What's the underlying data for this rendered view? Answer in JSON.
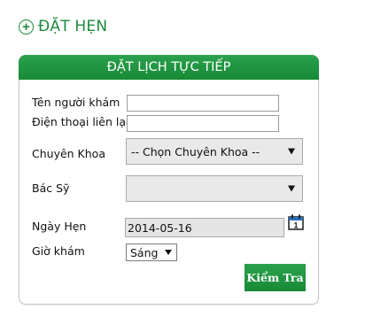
{
  "page": {
    "heading": "ĐẶT HẸN"
  },
  "form": {
    "title": "ĐẶT LỊCH TỰC TIẾP",
    "fields": {
      "patient_name": {
        "label": "Tên người khám",
        "value": ""
      },
      "phone": {
        "label": "Điện thoại liên lạc",
        "value": ""
      },
      "specialty": {
        "label": "Chuyên Khoa",
        "selected": "-- Chọn Chuyên Khoa --"
      },
      "doctor": {
        "label": "Bác Sỹ",
        "selected": ""
      },
      "date": {
        "label": "Ngày Hẹn",
        "value": "2014-05-16",
        "icon": "calendar-icon"
      },
      "time": {
        "label": "Giờ khám",
        "selected": "Sáng"
      }
    },
    "submit_label": "Kiểm Tra"
  },
  "colors": {
    "accent": "#1e8a3c",
    "header_bg": "#23974a"
  }
}
